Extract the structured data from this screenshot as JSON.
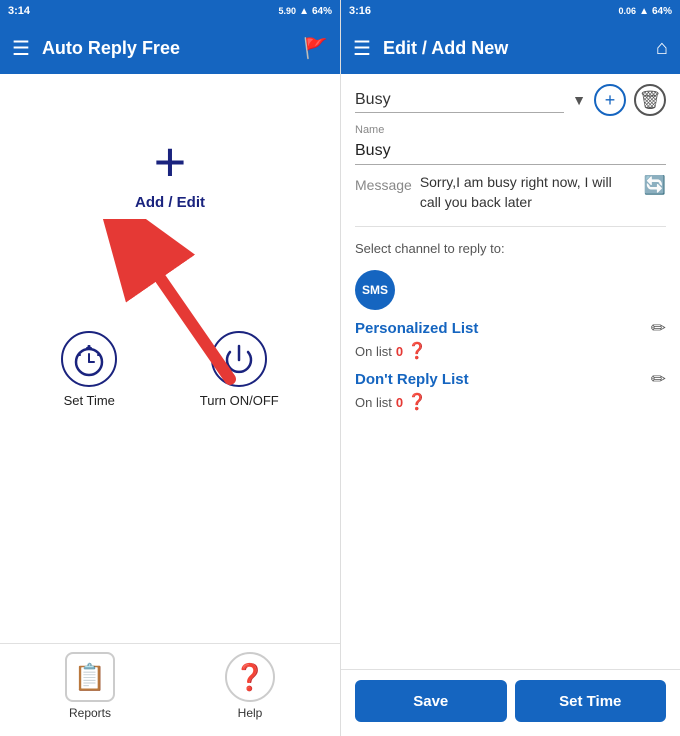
{
  "left": {
    "status_bar": {
      "time": "3:14",
      "network": "5.90",
      "battery": "64%"
    },
    "app_bar": {
      "title": "Auto Reply Free",
      "menu_icon": "☰",
      "action_icon": "⚑"
    },
    "add_edit": {
      "plus_label": "+",
      "label": "Add / Edit"
    },
    "set_time": {
      "label": "Set Time"
    },
    "turn_onoff": {
      "label": "Turn ON/OFF"
    },
    "footer": {
      "reports_label": "Reports",
      "help_label": "Help"
    }
  },
  "right": {
    "status_bar": {
      "time": "3:16",
      "network": "0.06",
      "battery": "64%"
    },
    "app_bar": {
      "title": "Edit / Add New",
      "menu_icon": "☰",
      "home_icon": "⌂"
    },
    "dropdown": {
      "value": "Busy",
      "arrow": "▼"
    },
    "name_label": "Name",
    "name_value": "Busy",
    "message_label": "Message",
    "message_text": "Sorry,I am busy right now, I will call you back later",
    "channel_label": "Select channel to reply to:",
    "sms_badge": "SMS",
    "personalized_list": {
      "title": "Personalized List",
      "on_list_label": "On list",
      "count": "0",
      "edit_icon": "✏"
    },
    "dont_reply_list": {
      "title": "Don't Reply List",
      "on_list_label": "On list",
      "count": "0",
      "edit_icon": "✏"
    },
    "save_btn": "Save",
    "settime_btn": "Set Time"
  }
}
